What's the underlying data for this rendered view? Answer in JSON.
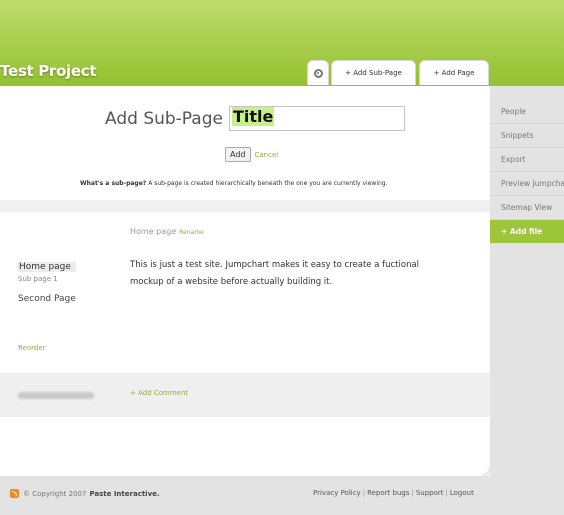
{
  "header": {
    "project_title": "Test Project",
    "tabs": {
      "gear_icon": "gear-icon",
      "add_subpage": "+ Add Sub-Page",
      "add_page": "+ Add Page"
    }
  },
  "add_subpage_form": {
    "heading": "Add Sub-Page",
    "title_value": "Title",
    "add_button": "Add",
    "cancel_link": "Cancel",
    "help_label": "What's a sub-page?",
    "help_text": "A sub-page is created hierarchically beneath the one you are currently viewing."
  },
  "page": {
    "heading": "Home page",
    "rename_link": "Rename",
    "content": "This is just a test site. Jumpchart makes it easy to create a fuctional mockup of a website before actually building it."
  },
  "page_tree": {
    "items": [
      {
        "label": "Home page"
      },
      {
        "label": "Sub page 1"
      },
      {
        "label": "Second Page"
      }
    ],
    "reorder_link": "Reorder"
  },
  "comments": {
    "add_comment": "+ Add Comment"
  },
  "right_nav": {
    "items": [
      "People",
      "Snippets",
      "Export",
      "Preview Jumpchart",
      "Sitemap View"
    ],
    "add_file": "+ Add file"
  },
  "footer": {
    "copyright": "© Copyright 2007",
    "company": "Paste Interactive.",
    "links": [
      "Privacy Policy",
      "Report bugs",
      "Support",
      "Logout"
    ]
  },
  "colors": {
    "brand_green": "#93c12f",
    "link_green": "#8ab33d",
    "highlight": "#c7f08a"
  }
}
